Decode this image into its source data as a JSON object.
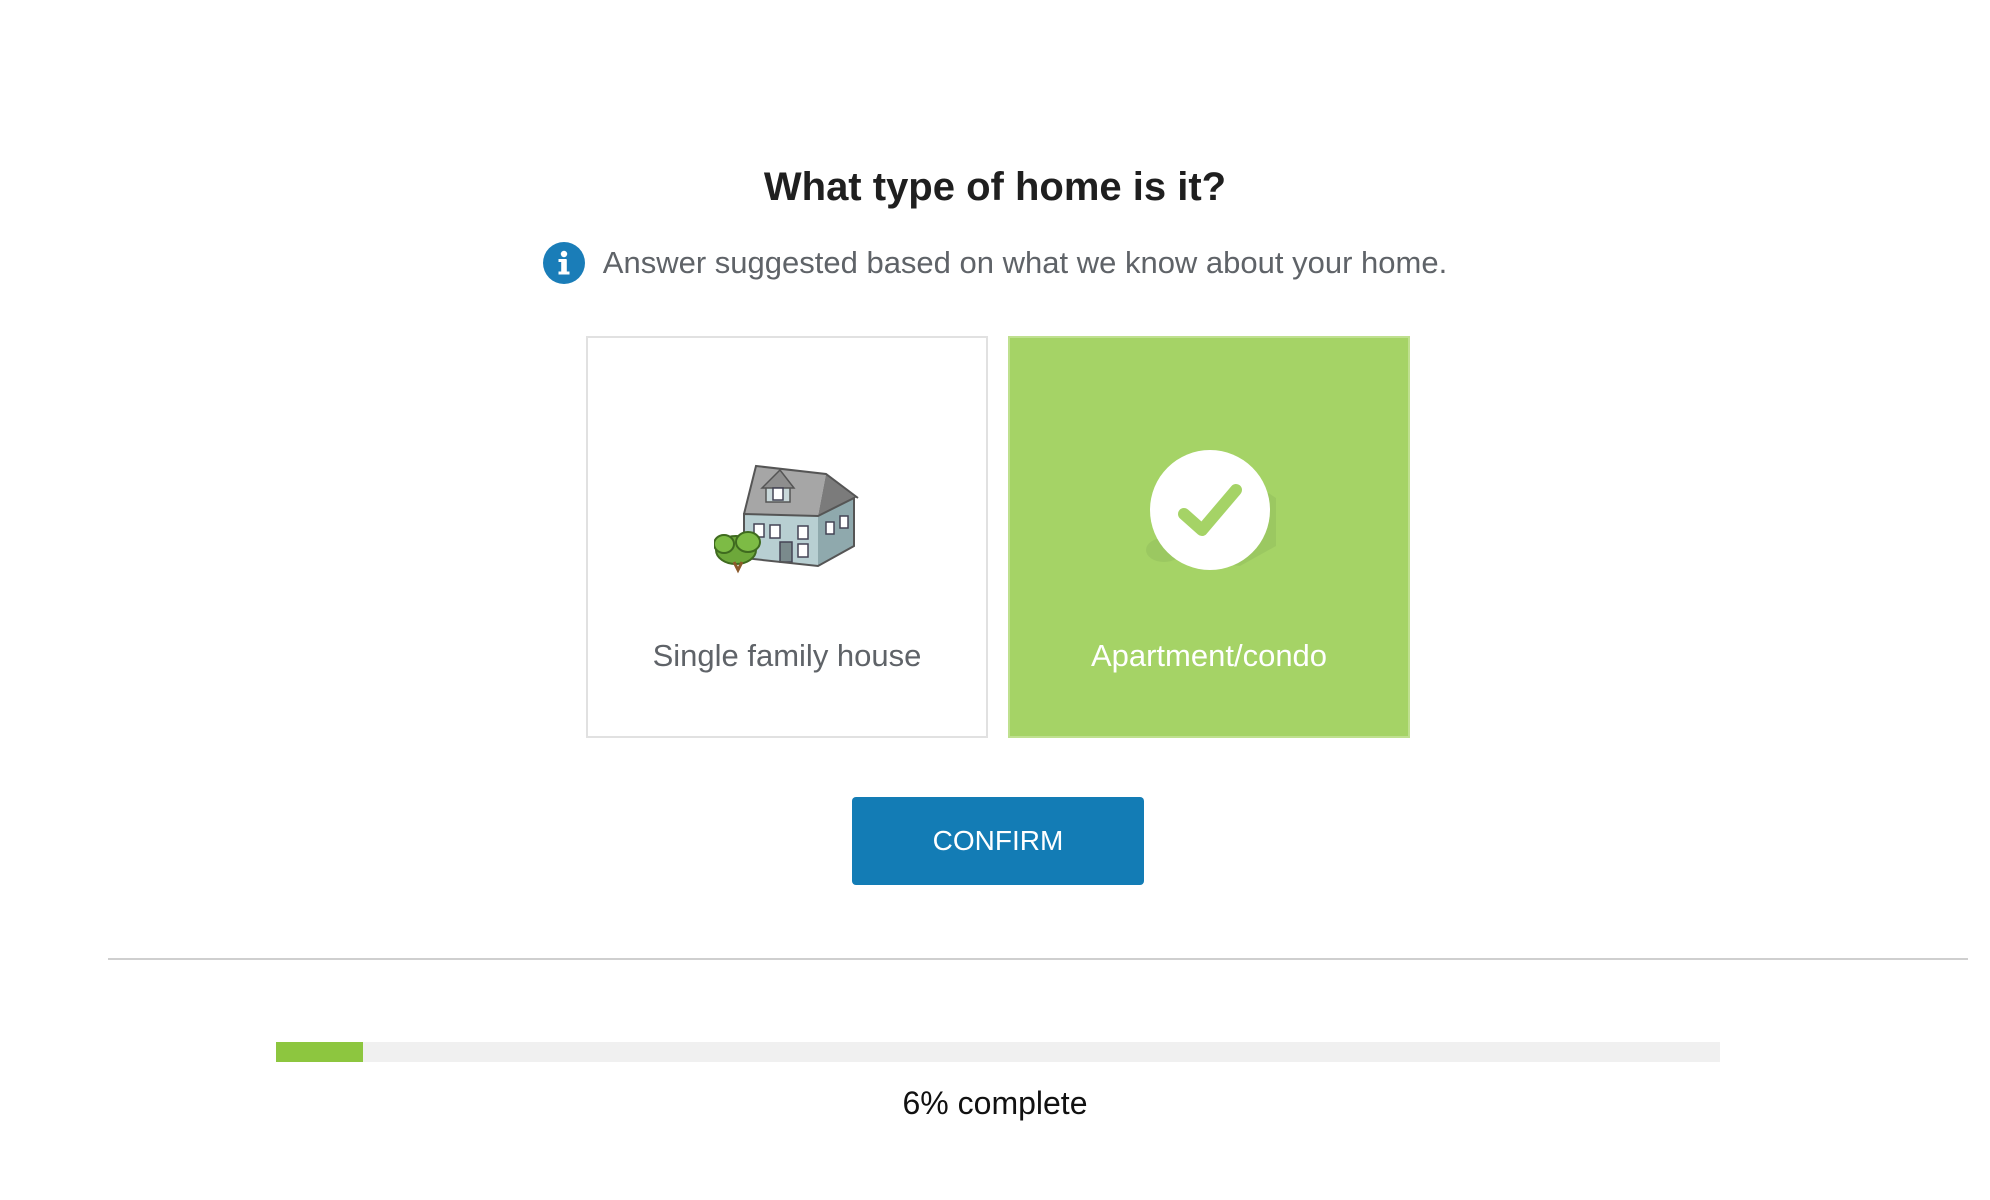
{
  "question": "What type of home is it?",
  "hint": {
    "icon": "info-icon",
    "text": "Answer suggested based on what we know about your home."
  },
  "options": [
    {
      "label": "Single family house",
      "icon": "house-icon",
      "selected": false
    },
    {
      "label": "Apartment/condo",
      "icon": "apartment-icon",
      "selected": true
    }
  ],
  "confirm_label": "CONFIRM",
  "progress": {
    "percent": 6,
    "text": "6% complete"
  },
  "colors": {
    "accent_blue": "#137cb5",
    "selected_green": "#a5d366",
    "progress_green": "#8dc63f"
  }
}
